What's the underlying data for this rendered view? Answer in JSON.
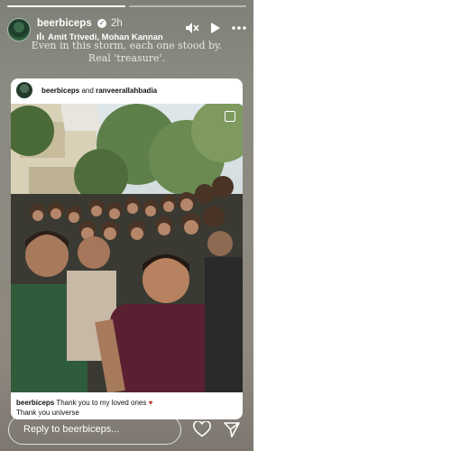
{
  "story": {
    "username": "beerbiceps",
    "time": "2h",
    "music": "Amit Trivedi, Mohan Kannan",
    "caption_line1": "Even in this storm, each one stood by.",
    "caption_line2": "Real 'treasure'."
  },
  "post": {
    "user1": "beerbiceps",
    "and_text": "and",
    "user2": "ranveerallahbadia",
    "caption_user": "beerbiceps",
    "caption_text": "Thank you to my loved ones",
    "caption_line2": "Thank you universe"
  },
  "reply": {
    "placeholder": "Reply to beerbiceps..."
  },
  "icons": [
    "mute-icon",
    "play-icon",
    "more-icon",
    "heart-icon",
    "send-icon",
    "verified-icon",
    "carousel-icon"
  ]
}
